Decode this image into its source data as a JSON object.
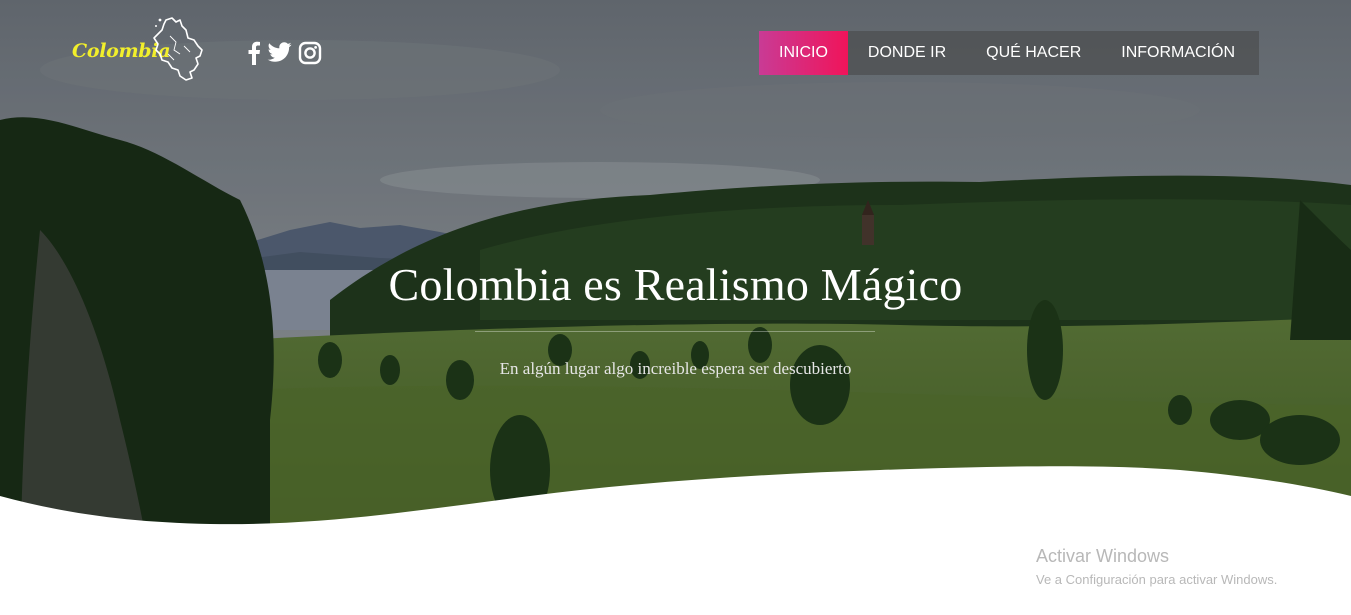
{
  "brand": {
    "name": "Colombia",
    "color": "#f2ef2b"
  },
  "social": [
    {
      "icon": "facebook-icon"
    },
    {
      "icon": "twitter-icon"
    },
    {
      "icon": "instagram-icon"
    }
  ],
  "nav": {
    "items": [
      {
        "label": "INICIO",
        "active": true
      },
      {
        "label": "DONDE IR",
        "active": false
      },
      {
        "label": "QUÉ HACER",
        "active": false
      },
      {
        "label": "INFORMACIÓN",
        "active": false
      }
    ],
    "active_gradient": [
      "#c93b95",
      "#f0145a"
    ]
  },
  "hero": {
    "title": "Colombia es Realismo Mágico",
    "subtitle": "En algún lugar algo increible espera ser descubierto"
  },
  "watermark": {
    "title": "Activar Windows",
    "subtitle": "Ve a Configuración para activar Windows."
  }
}
